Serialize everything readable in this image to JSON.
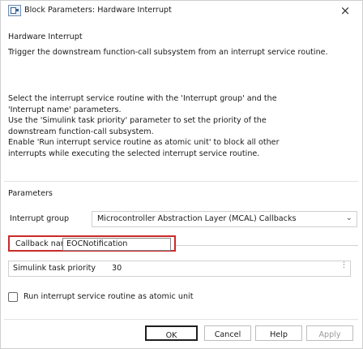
{
  "window": {
    "title": "Block Parameters: Hardware Interrupt",
    "close_glyph": "×"
  },
  "description": {
    "heading": "Hardware Interrupt",
    "paragraph1": "Trigger the downstream function-call subsystem from an interrupt service routine.",
    "paragraph2_lines": [
      "Select the interrupt service routine with the 'Interrupt group' and the",
      "'Interrupt name' parameters.",
      "Use the 'Simulink task priority' parameter to set the priority of the",
      "downstream function-call subsystem.",
      "Enable 'Run interrupt service routine as atomic unit' to block all other",
      "interrupts while executing the selected interrupt service routine."
    ]
  },
  "parameters": {
    "heading": "Parameters",
    "interrupt_group": {
      "label": "Interrupt group",
      "value": "Microcontroller Abstraction Layer (MCAL) Callbacks",
      "chevron_icon": "chevron-down-icon"
    },
    "callback_name": {
      "label": "Callback name",
      "value": "EOCNotification",
      "highlight_color": "#cc2a2a"
    },
    "task_priority": {
      "label": "Simulink task priority",
      "value": "30"
    },
    "atomic_unit": {
      "label": "Run interrupt service routine as atomic unit",
      "checked": false
    }
  },
  "buttons": {
    "ok": "OK",
    "cancel": "Cancel",
    "help": "Help",
    "apply": "Apply"
  }
}
